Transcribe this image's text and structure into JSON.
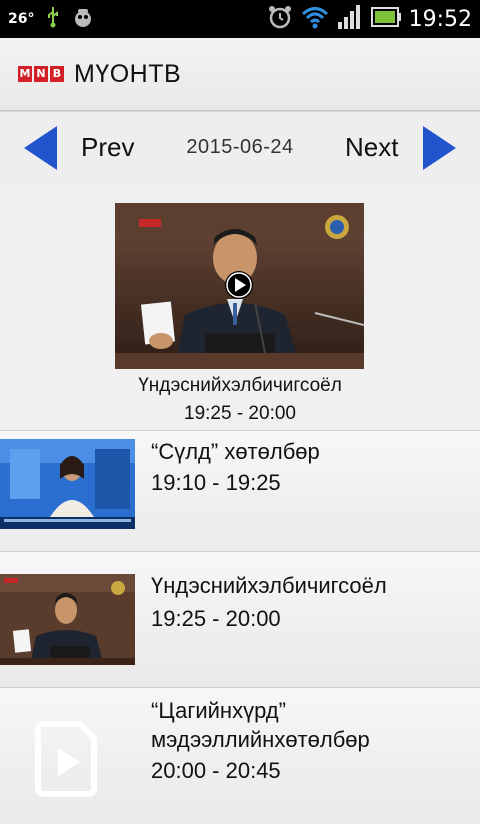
{
  "status_bar": {
    "temperature": "26°",
    "time": "19:52",
    "icons": [
      "usb-icon",
      "debug-icon",
      "alarm-icon",
      "wifi-icon",
      "signal-icon",
      "battery-icon"
    ]
  },
  "app_bar": {
    "logo_letters": [
      "M",
      "N",
      "B"
    ],
    "title": "МҮОНТВ"
  },
  "date_nav": {
    "prev_label": "Prev",
    "date": "2015-06-24",
    "next_label": "Next"
  },
  "featured": {
    "title": "Үндэснийхэлбичигсоёл",
    "time": "19:25 - 20:00",
    "thumb_logo": "MNB"
  },
  "programs": [
    {
      "title": "“Сүлд” хөтөлбөр",
      "time": "19:10 - 19:25",
      "thumbnail": "studio-presenter"
    },
    {
      "title": "Үндэснийхэлбичигсоёл",
      "time": "19:25 - 20:00",
      "thumbnail": "parliament-speaker"
    },
    {
      "title": "“Цагийнхүрд” мэдээллийнхөтөлбөр",
      "time": "20:00 - 20:45",
      "thumbnail": "video-file-placeholder"
    }
  ],
  "colors": {
    "arrow_blue": "#2255cc",
    "logo_red": "#d32027",
    "status_bg": "#000000"
  }
}
